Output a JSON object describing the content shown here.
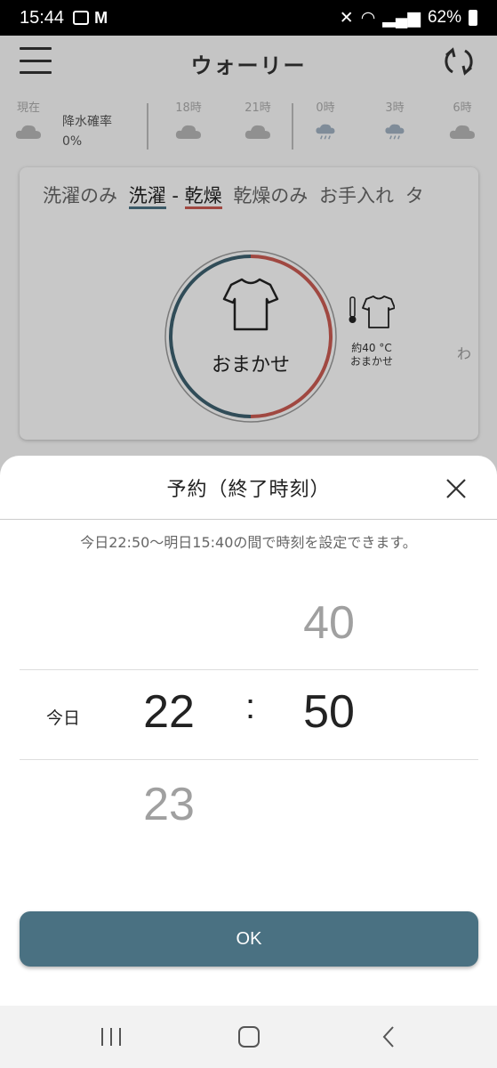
{
  "status_bar": {
    "time": "15:44",
    "battery": "62%"
  },
  "header": {
    "title": "ウォーリー"
  },
  "weather": {
    "now_label": "現在",
    "rain_label": "降水確率",
    "rain_value": "0%",
    "hours": [
      "18時",
      "21時",
      "0時",
      "3時",
      "6時"
    ]
  },
  "card": {
    "tabs": {
      "wash_only": "洗濯のみ",
      "wash": "洗濯",
      "dash": " - ",
      "dry": "乾燥",
      "dry_only": "乾燥のみ",
      "care": "お手入れ",
      "cut": "タ"
    },
    "dial_label": "おまかせ",
    "side_temp": "約40 °C",
    "side_mode": "おまかせ",
    "side_cut": "わ"
  },
  "sheet": {
    "title": "予約（終了時刻）",
    "hint": "今日22:50〜明日15:40の間で時刻を設定できます。",
    "picker": {
      "day_label": "今日",
      "hour_selected": "22",
      "hour_next": "23",
      "colon": ":",
      "minute_prev": "40",
      "minute_selected": "50"
    },
    "ok_label": "OK"
  },
  "colors": {
    "primary": "#4a7182",
    "accent_red": "#c95b52"
  }
}
